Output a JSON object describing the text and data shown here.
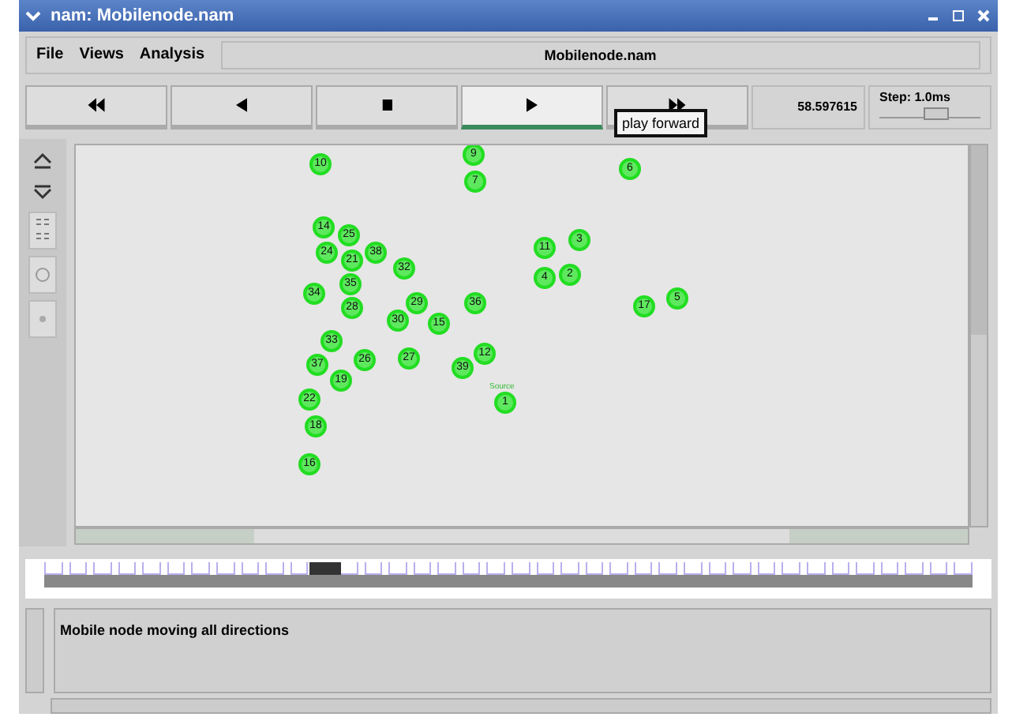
{
  "window": {
    "title": "nam: Mobilenode.nam"
  },
  "menu": [
    {
      "label": "File"
    },
    {
      "label": "Views"
    },
    {
      "label": "Analysis"
    }
  ],
  "file_name": "Mobilenode.nam",
  "controls": [
    {
      "kind": "rewind",
      "selected": false
    },
    {
      "kind": "back",
      "selected": false
    },
    {
      "kind": "stop",
      "selected": false
    },
    {
      "kind": "play",
      "selected": true
    },
    {
      "kind": "fast",
      "selected": false
    }
  ],
  "tooltip": "play forward",
  "time": "58.597615",
  "step": {
    "label": "Step: 1.0ms",
    "level": 0.55
  },
  "nodes": [
    {
      "label": "10"
    },
    {
      "label": "9"
    },
    {
      "label": "7"
    },
    {
      "label": "6"
    },
    {
      "label": "14"
    },
    {
      "label": "25"
    },
    {
      "label": "24"
    },
    {
      "label": "38"
    },
    {
      "label": "21"
    },
    {
      "label": "35"
    },
    {
      "label": "32"
    },
    {
      "label": "11"
    },
    {
      "label": "3"
    },
    {
      "label": "4"
    },
    {
      "label": "2"
    },
    {
      "label": "34"
    },
    {
      "label": "28"
    },
    {
      "label": "29"
    },
    {
      "label": "30"
    },
    {
      "label": "15"
    },
    {
      "label": "36"
    },
    {
      "label": "17"
    },
    {
      "label": "5"
    },
    {
      "label": "33"
    },
    {
      "label": "37"
    },
    {
      "label": "26"
    },
    {
      "label": "27"
    },
    {
      "label": "12"
    },
    {
      "label": "39"
    },
    {
      "label": "19"
    },
    {
      "label": "1"
    },
    {
      "label": "22"
    },
    {
      "label": "18"
    },
    {
      "label": "16"
    }
  ],
  "node_note": "Source",
  "timeline": {
    "level": 0.31
  },
  "annotation": "Mobile node moving all directions"
}
